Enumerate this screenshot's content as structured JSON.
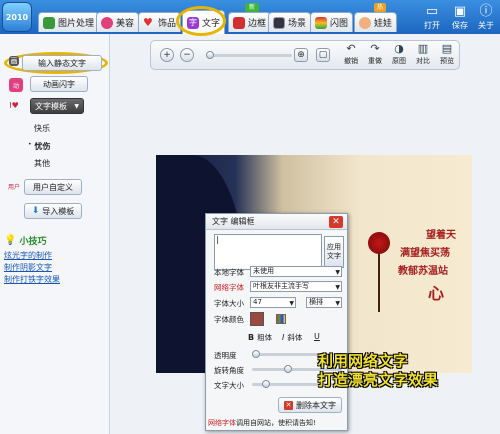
{
  "app": {
    "logo": "2010"
  },
  "tabs": [
    {
      "label": "图片处理"
    },
    {
      "label": "美容"
    },
    {
      "label": "饰品"
    },
    {
      "label": "文字"
    },
    {
      "label": "边框",
      "badge": "新"
    },
    {
      "label": "场景"
    },
    {
      "label": "闪图"
    },
    {
      "label": "娃娃",
      "badge": "热"
    }
  ],
  "top_actions": {
    "open": "打开",
    "save": "保存",
    "about": "关于"
  },
  "sidebar": {
    "static_text": "输入静态文字",
    "anim_text": "动画闪字",
    "template": "文字模板",
    "template_items": [
      "快乐",
      "忧伤",
      "其他"
    ],
    "user_custom": "用户自定义",
    "import_template": "导入模板",
    "tips_title": "小技巧",
    "tips_links": [
      "炫光字的制作",
      "制作阴影文字",
      "制作打铁字效果"
    ]
  },
  "toolbar": {
    "undo": "撤销",
    "redo": "重做",
    "original": "原图",
    "compare": "对比",
    "preview": "预览"
  },
  "poem": {
    "line1": "望着天",
    "line2": "满望焦买荡",
    "line3": "教郁苏温站",
    "line4": "心"
  },
  "dialog": {
    "title": "文字 编辑框",
    "apply": "应用文字",
    "local_font_label": "本地字体",
    "local_font_value": "未使用",
    "web_font_label": "网络字体",
    "web_font_value": "叶根友非主流手写",
    "size_label": "字体大小",
    "size_value": "47",
    "direction_value": "横排",
    "color_label": "字体颜色",
    "bold": "粗体",
    "italic": "斜体",
    "transparency": "透明度",
    "rotation": "旋转角度",
    "text_size": "文字大小",
    "delete_text": "删除本文字",
    "footer_red": "网络字体",
    "footer_rest": "调用自网站，使积请告知!"
  },
  "overlay": {
    "line1": "利用网络文字",
    "line2": "打造漂亮文字效果"
  },
  "colors": {
    "accent": "#1d66c1",
    "highlight_ring": "#e7b400",
    "font_color": "#9a4a3e"
  }
}
